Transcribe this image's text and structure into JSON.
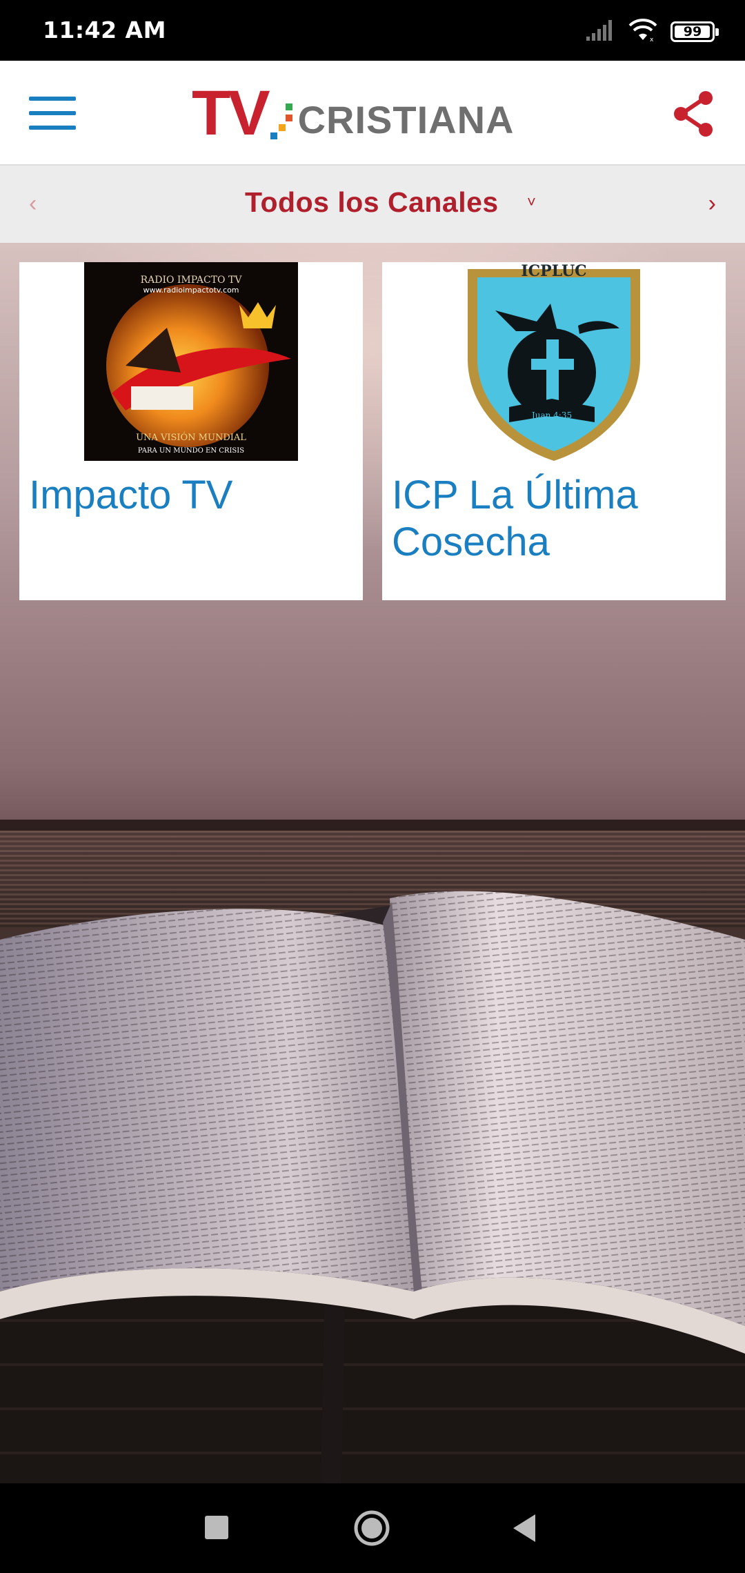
{
  "status_bar": {
    "time": "11:42 AM",
    "battery": "99",
    "battery_fraction": 0.99,
    "signal_icon": "cell-signal-icon",
    "wifi_icon": "wifi-icon"
  },
  "app_bar": {
    "logo_tv": "TV",
    "logo_word": "CRISTIANA",
    "menu_icon": "hamburger-menu-icon",
    "share_icon": "share-icon",
    "brand_red": "#c8222f",
    "brand_blue": "#1a7fc1"
  },
  "channel_bar": {
    "title": "Todos los Canales",
    "caret": "˅",
    "prev": "‹",
    "next": "›"
  },
  "channels": [
    {
      "name": "Impacto TV",
      "logo_text_top": "RADIO IMPACTO TV",
      "logo_text_url": "www.radioimpactotv.com",
      "logo_text_bottom": "UNA VISIÓN MUNDIAL",
      "logo_text_footer": "PARA UN MUNDO EN CRISIS"
    },
    {
      "name": "ICP La Última Cosecha",
      "logo_text_top": "ICPLUC",
      "logo_text_verse": "Juan 4:35"
    }
  ],
  "nav_bar": {
    "recents_icon": "square-recents-icon",
    "home_icon": "circle-home-icon",
    "back_icon": "triangle-back-icon"
  }
}
